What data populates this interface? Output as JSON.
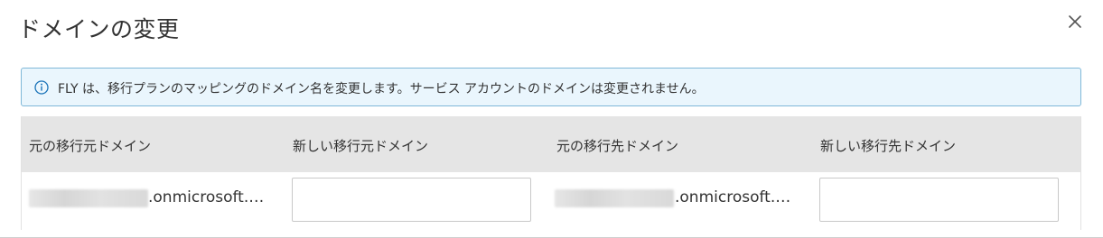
{
  "dialog": {
    "title": "ドメインの変更",
    "close_icon": "close-icon"
  },
  "info_banner": {
    "icon": "info-icon",
    "text": "FLY は、移行プランのマッピングのドメイン名を変更します。サービス アカウントのドメインは変更されません。"
  },
  "table": {
    "columns": [
      "元の移行元ドメイン",
      "新しい移行元ドメイン",
      "元の移行先ドメイン",
      "新しい移行先ドメイン"
    ],
    "rows": [
      {
        "source_domain_suffix": ".onmicrosoft.…",
        "new_source_domain_value": "",
        "destination_domain_suffix": ".onmicrosoft.…",
        "new_destination_domain_value": ""
      }
    ]
  },
  "colors": {
    "banner_background": "#eaf6fd",
    "banner_border": "#7fb8d8",
    "info_icon": "#1a73b8",
    "header_background": "#e5e5e5",
    "input_border": "#c8c8c8"
  }
}
